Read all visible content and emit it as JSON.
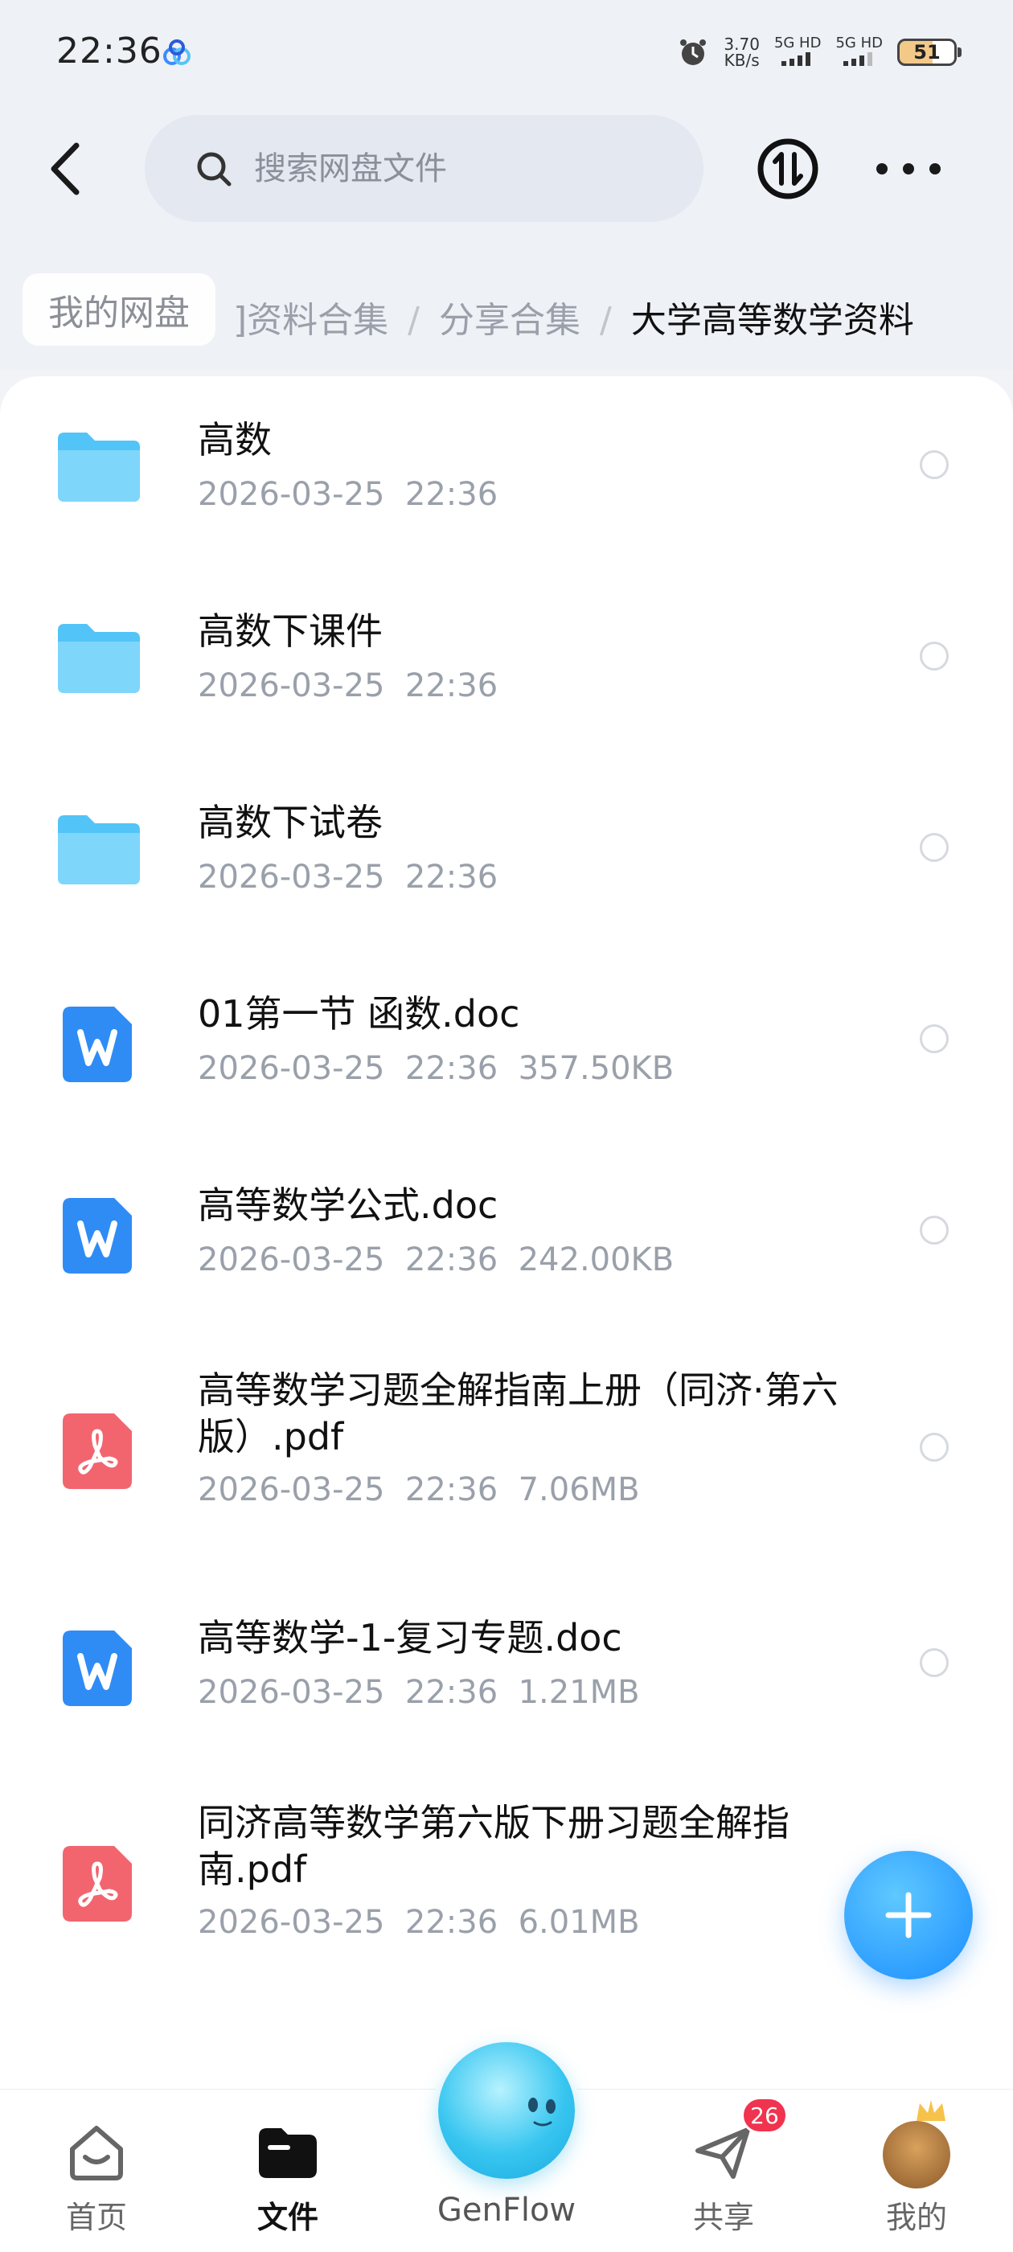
{
  "status_bar": {
    "time": "22:36",
    "net_speed_value": "3.70",
    "net_speed_unit": "KB/s",
    "sim1": "5G HD",
    "sim2": "5G HD",
    "battery": "51"
  },
  "top_bar": {
    "search_placeholder": "搜索网盘文件"
  },
  "breadcrumb": {
    "home": "我的网盘",
    "items": [
      "资料合集",
      "分享合集"
    ],
    "partial_first": "]资料合集",
    "current": "大学高等数学资料"
  },
  "files": [
    {
      "name": "高数",
      "meta": "2026-03-25  22:36",
      "type": "folder"
    },
    {
      "name": "高数下课件",
      "meta": "2026-03-25  22:36",
      "type": "folder"
    },
    {
      "name": "高数下试卷",
      "meta": "2026-03-25  22:36",
      "type": "folder"
    },
    {
      "name": "01第一节  函数.doc",
      "meta": "2026-03-25  22:36  357.50KB",
      "type": "doc"
    },
    {
      "name": "高等数学公式.doc",
      "meta": "2026-03-25  22:36  242.00KB",
      "type": "doc"
    },
    {
      "name": "高等数学习题全解指南上册（同济·第六版）.pdf",
      "meta": "2026-03-25  22:36  7.06MB",
      "type": "pdf"
    },
    {
      "name": "高等数学-1-复习专题.doc",
      "meta": "2026-03-25  22:36  1.21MB",
      "type": "doc"
    },
    {
      "name": "同济高等数学第六版下册习题全解指南.pdf",
      "meta": "2026-03-25  22:36  6.01MB",
      "type": "pdf"
    }
  ],
  "bottom_nav": {
    "home": "首页",
    "files": "文件",
    "genflow": "GenFlow",
    "share": "共享",
    "share_badge": "26",
    "me": "我的"
  },
  "colors": {
    "folder": "#52c4f7",
    "doc": "#2f8cf5",
    "pdf": "#f2656f",
    "accent": "#1a8dff",
    "badge": "#f0334f"
  }
}
